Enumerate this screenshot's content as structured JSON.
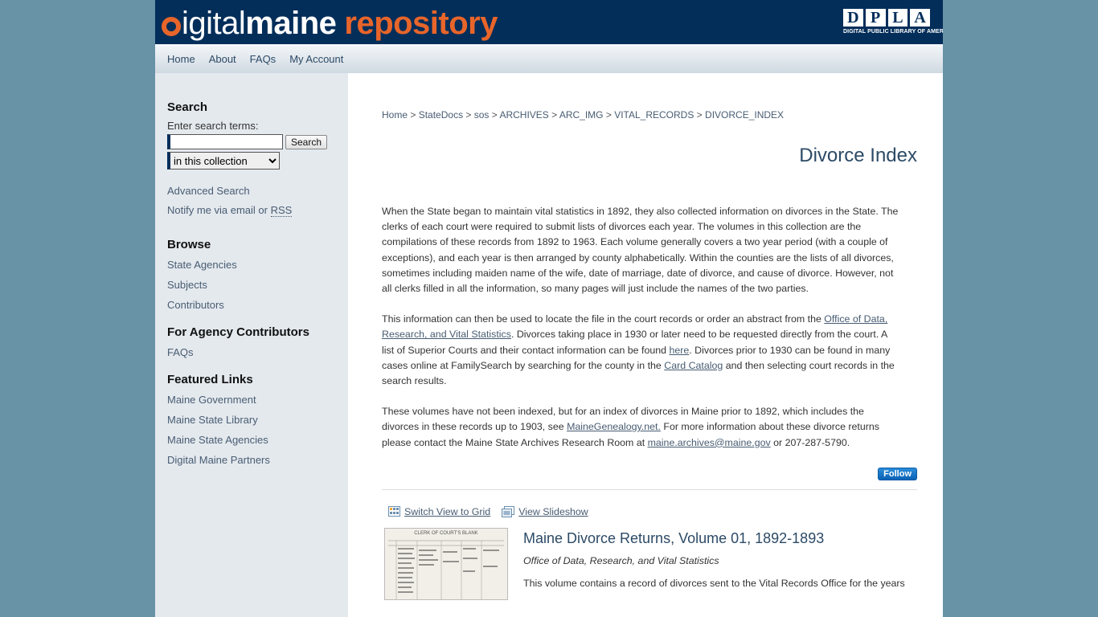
{
  "header": {
    "logo": {
      "part1": "igital",
      "part2": "maine",
      "part3": "repository"
    },
    "dpla": {
      "letters": [
        "D",
        "P",
        "L",
        "A"
      ],
      "subtitle": "DIGITAL PUBLIC LIBRARY OF AMERICA"
    }
  },
  "nav": {
    "items": [
      "Home",
      "About",
      "FAQs",
      "My Account"
    ]
  },
  "sidebar": {
    "search_heading": "Search",
    "search_label": "Enter search terms:",
    "search_value": "",
    "search_button": "Search",
    "scope_selected": "in this collection",
    "advanced_search": "Advanced Search",
    "notify_text": "Notify me via email or ",
    "notify_rss": "RSS",
    "browse_heading": "Browse",
    "browse_items": [
      "State Agencies",
      "Subjects",
      "Contributors"
    ],
    "agency_heading": "For Agency Contributors",
    "agency_items": [
      "FAQs"
    ],
    "featured_heading": "Featured Links",
    "featured_items": [
      "Maine Government",
      "Maine State Library",
      "Maine State Agencies",
      "Digital Maine Partners"
    ]
  },
  "breadcrumb": [
    "Home",
    "StateDocs",
    "sos",
    "ARCHIVES",
    "ARC_IMG",
    "VITAL_RECORDS",
    "DIVORCE_INDEX"
  ],
  "breadcrumb_sep": " > ",
  "page_title": "Divorce Index",
  "description": {
    "p1": "When the State began to maintain vital statistics in 1892, they also collected information on divorces in the State. The clerks of each court were required to submit lists of divorces each year. The volumes in this collection are the compilations of these records from 1892 to 1963. Each volume generally covers a two year period (with a couple of exceptions), and each year is then arranged by county alphabetically. Within the counties are the lists of all divorces, sometimes including maiden name of the wife, date of marriage, date of divorce, and cause of divorce. However, not all clerks filled in all the information, so many pages will just include the names of the two parties.",
    "p2a": "This information can then be used to locate the file in the court records or order an abstract from the ",
    "p2_link1": "Office of Data, Research, and Vital Statistics",
    "p2b": ". Divorces taking place in 1930 or later need to be requested directly from the court. A list of Superior Courts and their contact information can be found ",
    "p2_link2": "here",
    "p2c": ". Divorces prior to 1930 can be found in many cases online at FamilySearch by searching for the county in the ",
    "p2_link3": "Card Catalog",
    "p2d": " and then selecting court records in the search results.",
    "p3a": "These volumes have not been indexed, but for an index of divorces in Maine prior to 1892, which includes the divorces in these records up to 1903, see ",
    "p3_link1": "MaineGenealogy.net.",
    "p3b": " For more information about these divorce returns please contact the Maine State Archives Research Room at ",
    "p3_link2": "maine.archives@maine.gov",
    "p3c": " or 207-287-5790."
  },
  "follow_button": "Follow",
  "view_options": {
    "grid": "Switch View to Grid",
    "slideshow": "View Slideshow"
  },
  "item": {
    "thumb_caption": "CLERK OF COURT'S BLANK",
    "title": "Maine Divorce Returns, Volume 01, 1892-1893",
    "author": "Office of Data, Research, and Vital Statistics",
    "abstract": "This volume contains a record of divorces sent to the Vital Records Office for the years"
  }
}
